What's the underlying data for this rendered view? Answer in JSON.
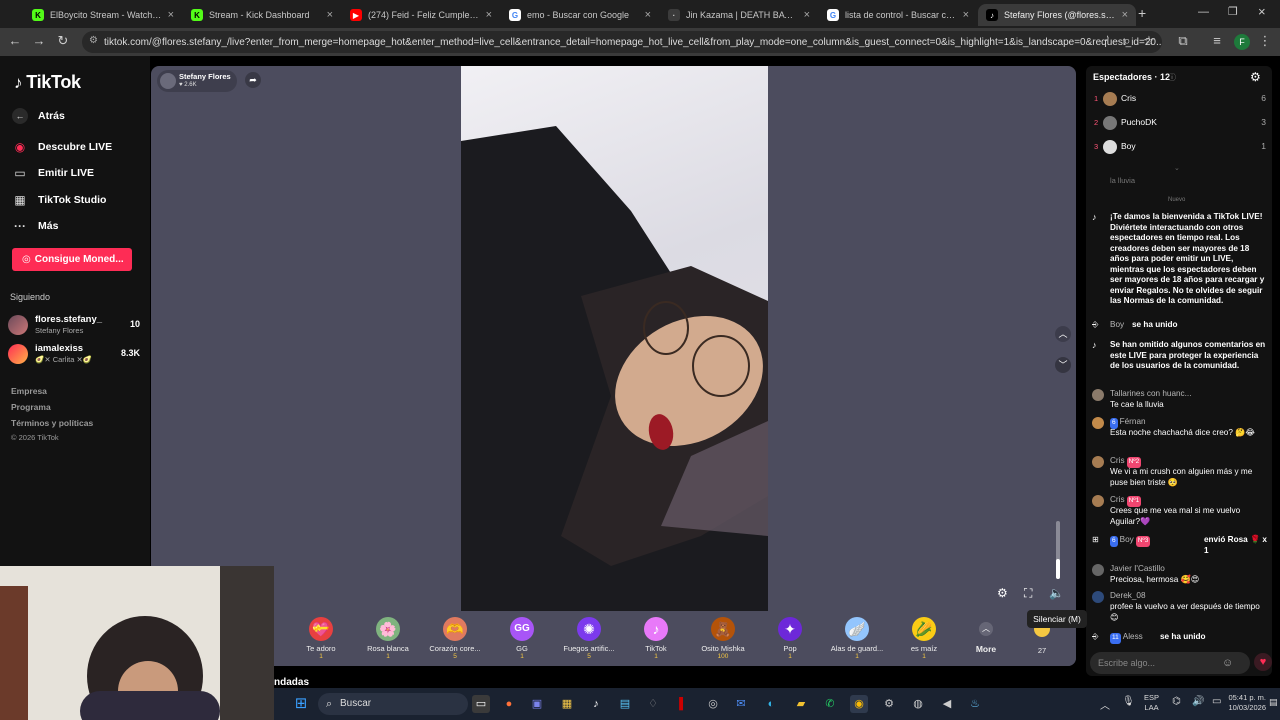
{
  "browser": {
    "tabs": [
      {
        "title": "ElBoycito Stream - Watch Live o",
        "color": "#53fc18",
        "glyph": "K"
      },
      {
        "title": "Stream - Kick Dashboard",
        "color": "#53fc18",
        "glyph": "K"
      },
      {
        "title": "(274) Feid - Feliz Cumpleaños F",
        "color": "#ff0000",
        "glyph": "▶"
      },
      {
        "title": "emo - Buscar con Google",
        "color": "#ffffff",
        "glyph": "G"
      },
      {
        "title": "Jin Kazama | DEATH BATTLE! W",
        "color": "#3b3b3b",
        "glyph": "·"
      },
      {
        "title": "lista de control - Buscar con Go",
        "color": "#ffffff",
        "glyph": "G"
      },
      {
        "title": "Stefany Flores (@flores.stef",
        "color": "#000000",
        "glyph": "♪"
      }
    ],
    "new_tab": "+",
    "url": "tiktok.com/@flores.stefany_/live?enter_from_merge=homepage_hot&enter_method=live_cell&entrance_detail=homepage_hot_live_cell&from_play_mode=one_column&is_guest_connect=0&is_highlight=1&is_landscape=0&request_id=20...",
    "profile_letter": "F"
  },
  "sidebar": {
    "logo": "TikTok",
    "back": "Atrás",
    "nav": [
      {
        "label": "Descubre LIVE",
        "icon": "◉"
      },
      {
        "label": "Emitir LIVE",
        "icon": "▭"
      },
      {
        "label": "TikTok Studio",
        "icon": "▦"
      },
      {
        "label": "Más",
        "icon": "···"
      }
    ],
    "coins_button": "Consigue Moned...",
    "following_title": "Siguiendo",
    "following": [
      {
        "name": "flores.stefany_",
        "sub": "Stefany Flores",
        "count": "10"
      },
      {
        "name": "iamalexiss",
        "sub": "🥑✕ Carlita ✕🥑",
        "count": "8.3K"
      }
    ],
    "footer": [
      "Empresa",
      "Programa",
      "Términos y políticas",
      "© 2026 TikTok"
    ]
  },
  "live": {
    "host_name": "Stefany Flores",
    "host_likes": "♥ 2.6K",
    "tooltip": "Silenciar (M)",
    "gifts": [
      {
        "name": "Te adoro",
        "price": "1",
        "icon": "💝",
        "color": "#e84040"
      },
      {
        "name": "Rosa blanca",
        "price": "1",
        "icon": "🌸",
        "color": "#7fb37f"
      },
      {
        "name": "Corazón core...",
        "price": "5",
        "icon": "🫶",
        "color": "#e07a5f"
      },
      {
        "name": "GG",
        "price": "1",
        "icon": "GG",
        "color": "#a855f7"
      },
      {
        "name": "Fuegos artific...",
        "price": "5",
        "icon": "✺",
        "color": "#7c3aed"
      },
      {
        "name": "TikTok",
        "price": "1",
        "icon": "♪",
        "color": "#e879f9"
      },
      {
        "name": "Osito Mishka",
        "price": "100",
        "icon": "🧸",
        "color": "#b45309"
      },
      {
        "name": "Pop",
        "price": "1",
        "icon": "✦",
        "color": "#6d28d9"
      },
      {
        "name": "Alas de guard...",
        "price": "1",
        "icon": "🪽",
        "color": "#93c5fd"
      },
      {
        "name": "es maíz",
        "price": "1",
        "icon": "🌽",
        "color": "#facc15"
      }
    ],
    "more_label": "More",
    "coin_count": "27",
    "partial_text": "ndadas"
  },
  "chat": {
    "viewers_title": "Espectadores · 12",
    "viewers": [
      {
        "rank": "1",
        "name": "Cris",
        "score": "6",
        "color": "#a67c52"
      },
      {
        "rank": "2",
        "name": "PuchoDK",
        "score": "3",
        "color": "#777"
      },
      {
        "rank": "3",
        "name": "Boy",
        "score": "1",
        "color": "#ddd"
      }
    ],
    "faded_text": "la lluvia",
    "new_label": "Nuevo",
    "welcome": "¡Te damos la bienvenida a TikTok LIVE! Diviértete interactuando con otros espectadores en tiempo real. Los creadores deben ser mayores de 18 años para poder emitir un LIVE, mientras que los espectadores deben ser mayores de 18 años para recargar y enviar Regalos. No te olvides de seguir las Normas de la comunidad.",
    "joined_boy": {
      "user": "Boy",
      "text": "se ha unido"
    },
    "omitted": "Se han omitido algunos comentarios en este LIVE para proteger la experiencia de los usuarios de la comunidad.",
    "messages": [
      {
        "user": "Tallarines con huanc...",
        "text": "Te cae la lluvia",
        "badges": []
      },
      {
        "user": "Férnan",
        "text": "Esta noche chachachá dice creo? 🤔😂",
        "badges": [
          "6"
        ]
      },
      {
        "user": "Cris",
        "text": "We vi a mi crush con alguien más y me puse bien triste 🥺",
        "badges": [
          "Nº2"
        ]
      },
      {
        "user": "Cris",
        "text": "Crees que me vea mal si me vuelvo Aguilar?💜",
        "badges": [
          "Nº1"
        ]
      },
      {
        "user": "Boy",
        "text": "envió Rosa 🌹 x 1",
        "badges": [
          "6",
          "Nº3"
        ]
      },
      {
        "user": "Javier I'Castillo",
        "text": "Preciosa, hermosa 🥰😍",
        "badges": []
      },
      {
        "user": "Derek_08",
        "text": "profee la vuelvo a ver después de tiempo😊",
        "badges": []
      }
    ],
    "joined_last": {
      "user": "Aless",
      "text": "se ha unido",
      "badge": "11"
    },
    "composer_placeholder": "Escribe algo..."
  },
  "taskbar": {
    "search": "Buscar",
    "lang": "ESP",
    "lang2": "LAA",
    "time": "05:41 p. m.",
    "date": "10/03/2026"
  }
}
